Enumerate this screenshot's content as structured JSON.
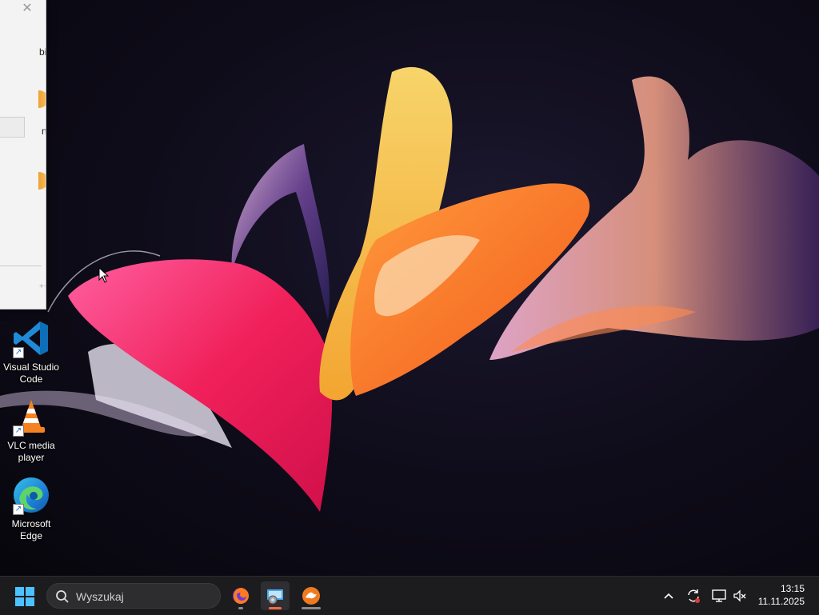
{
  "desktop_icons": [
    {
      "label_line1": "Visual Studio",
      "label_line2": "Code",
      "icon": "vscode-icon"
    },
    {
      "label_line1": "VLC media",
      "label_line2": "player",
      "icon": "vlc-icon"
    },
    {
      "label_line1": "Microsoft",
      "label_line2": "Edge",
      "icon": "edge-icon"
    }
  ],
  "window_fragment": {
    "close_glyph": "✕",
    "frag1": "bin",
    "frag2": "ng",
    "frag3": "++"
  },
  "taskbar": {
    "search_placeholder": "Wyszukaj",
    "apps": [
      {
        "name": "firefox-icon",
        "active": false
      },
      {
        "name": "system-app-icon",
        "active": true
      },
      {
        "name": "app-orange-icon",
        "active": false
      }
    ],
    "tray": {
      "overflow_icon": "chevron-up-icon",
      "sync_icon": "sync-icon",
      "network_icon": "network-icon",
      "volume_icon": "volume-muted-icon"
    },
    "clock": {
      "time": "13:15",
      "date": "11.11.2025"
    }
  },
  "colors": {
    "taskbar_bg": "#1c1c1e",
    "accent_blue": "#2196f3",
    "accent_orange": "#f07a20"
  }
}
